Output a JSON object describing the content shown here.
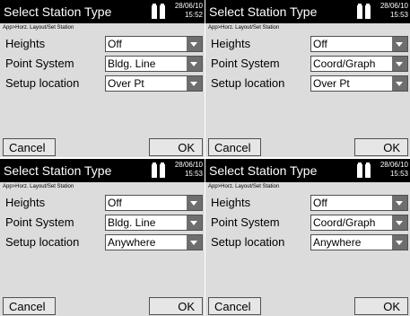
{
  "colors": {
    "titlebar": "#000000",
    "panel": "#dcdcdc",
    "field": "#ffffff",
    "dropdown_arrow": "#6e6e6e"
  },
  "screens": [
    {
      "title": "Select Station Type",
      "date": "28/06/10",
      "time": "15:52",
      "battery_icon": "battery-icon",
      "breadcrumb": "App>Horz. Layout/Set Station",
      "fields": [
        {
          "label": "Heights",
          "value": "Off"
        },
        {
          "label": "Point System",
          "value": "Bldg. Line"
        },
        {
          "label": "Setup location",
          "value": "Over Pt"
        }
      ],
      "cancel": "Cancel",
      "ok": "OK"
    },
    {
      "title": "Select Station Type",
      "date": "28/06/10",
      "time": "15:53",
      "battery_icon": "battery-icon",
      "breadcrumb": "App>Horz. Layout/Set Station",
      "fields": [
        {
          "label": "Heights",
          "value": "Off"
        },
        {
          "label": "Point System",
          "value": "Coord/Graph"
        },
        {
          "label": "Setup location",
          "value": "Over Pt"
        }
      ],
      "cancel": "Cancel",
      "ok": "OK"
    },
    {
      "title": "Select Station Type",
      "date": "28/06/10",
      "time": "15:53",
      "battery_icon": "battery-icon",
      "breadcrumb": "App>Horz. Layout/Set Station",
      "fields": [
        {
          "label": "Heights",
          "value": "Off"
        },
        {
          "label": "Point System",
          "value": "Bldg. Line"
        },
        {
          "label": "Setup location",
          "value": "Anywhere"
        }
      ],
      "cancel": "Cancel",
      "ok": "OK"
    },
    {
      "title": "Select Station Type",
      "date": "28/06/10",
      "time": "15:53",
      "battery_icon": "battery-icon",
      "breadcrumb": "App>Horz. Layout/Set Station",
      "fields": [
        {
          "label": "Heights",
          "value": "Off"
        },
        {
          "label": "Point System",
          "value": "Coord/Graph"
        },
        {
          "label": "Setup location",
          "value": "Anywhere"
        }
      ],
      "cancel": "Cancel",
      "ok": "OK"
    }
  ]
}
